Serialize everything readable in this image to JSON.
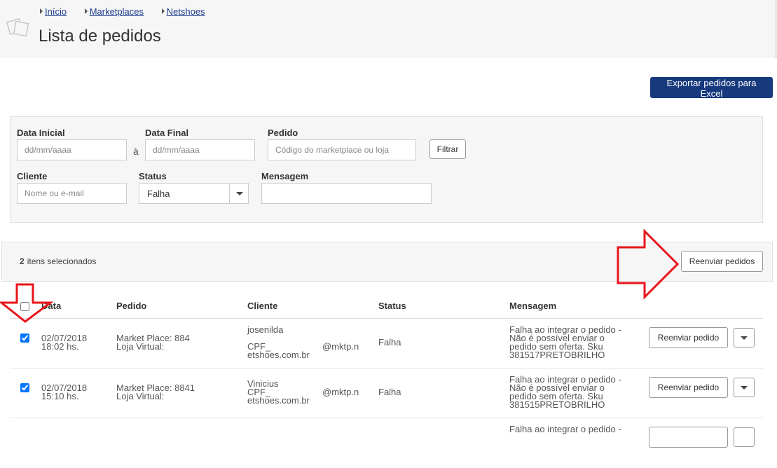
{
  "breadcrumb": [
    "Início",
    "Marketplaces",
    "Netshoes"
  ],
  "page_title": "Lista de pedidos",
  "export_button": "Exportar pedidos para Excel",
  "filters": {
    "start_date": {
      "label": "Data Inicial",
      "placeholder": "dd/mm/aaaa"
    },
    "separator": "à",
    "end_date": {
      "label": "Data Final",
      "placeholder": "dd/mm/aaaa"
    },
    "order": {
      "label": "Pedido",
      "placeholder": "Código do marketplace ou loja"
    },
    "filter_button": "Filtrar",
    "client": {
      "label": "Cliente",
      "placeholder": "Nome ou e-mail"
    },
    "status": {
      "label": "Status",
      "value": "Falha"
    },
    "message": {
      "label": "Mensagem",
      "placeholder": ""
    }
  },
  "selection": {
    "count": "2",
    "text": "itens selecionados",
    "resend_all_button": "Reenviar pedidos"
  },
  "table": {
    "headers": {
      "date": "Data",
      "order": "Pedido",
      "client": "Cliente",
      "status": "Status",
      "message": "Mensagem"
    },
    "rows": [
      {
        "checked": true,
        "date": "02/07/2018",
        "time": "18:02 hs.",
        "market_place": "Market Place: 884",
        "virtual_store": "Loja Virtual:",
        "client_name": "josenilda",
        "client_cpf": "CPF_",
        "client_email_a": "@mktp.n",
        "client_email_b": "etshoes.com.br",
        "status": "Falha",
        "message": [
          "Falha ao integrar o pedido -",
          "Não é possível enviar o",
          "pedido sem oferta. Sku",
          "381517PRETOBRILHO"
        ],
        "resend_button": "Reenviar pedido"
      },
      {
        "checked": true,
        "date": "02/07/2018",
        "time": "15:10 hs.",
        "market_place": "Market Place: 8841",
        "virtual_store": "Loja Virtual:",
        "client_name": "Vinicius",
        "client_cpf": "CPF_",
        "client_email_a": "@mktp.n",
        "client_email_b": "etshoes.com.br",
        "status": "Falha",
        "message": [
          "Falha ao integrar o pedido -",
          "Não é possível enviar o",
          "pedido sem oferta. Sku",
          "381515PRETOBRILHO"
        ],
        "resend_button": "Reenviar pedido"
      },
      {
        "message": [
          "Falha ao integrar o pedido -"
        ]
      }
    ]
  },
  "colors": {
    "primary": "#17397d",
    "annotation_arrow": "#e8161c",
    "link": "#1f3f8f"
  }
}
